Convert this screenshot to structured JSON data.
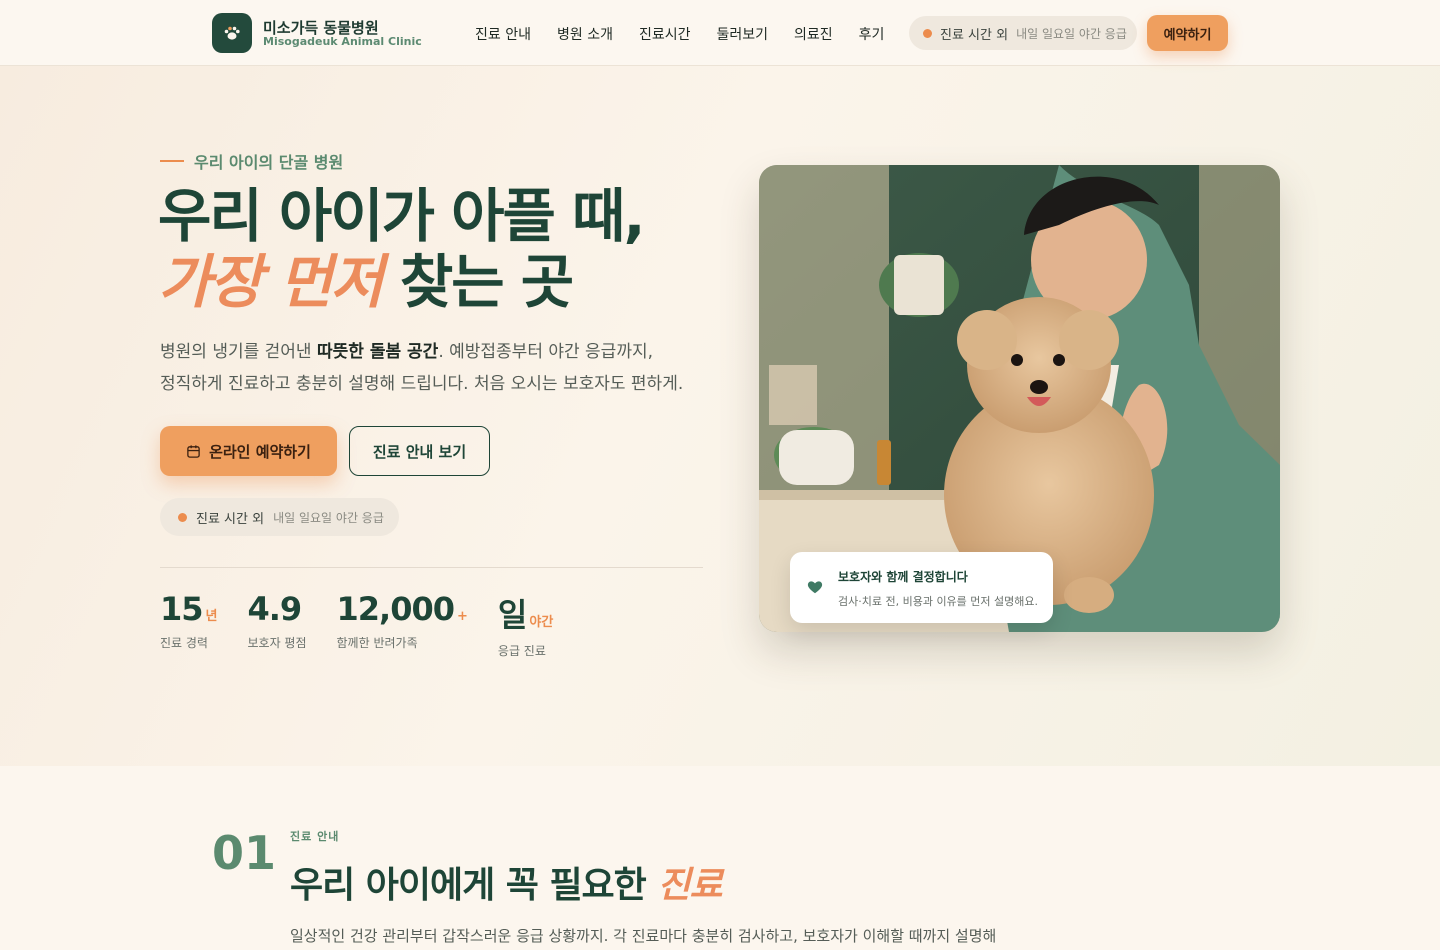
{
  "header": {
    "logo_name": "미소가득 동물병원",
    "logo_sub": "Misogadeuk Animal Clinic",
    "nav": [
      "진료 안내",
      "병원 소개",
      "진료시간",
      "둘러보기",
      "의료진",
      "후기"
    ],
    "hours_main": "진료 시간 외",
    "hours_sub": "내일 일요일 야간 응급",
    "book_label": "예약하기"
  },
  "hero": {
    "eyebrow": "우리 아이의 단골 병원",
    "title_line1": "우리 아이가 아플 때,",
    "title_accent": "가장 먼저",
    "title_rest": " 찾는 곳",
    "lead_pre": "병원의 냉기를 걷어낸 ",
    "lead_bold": "따뜻한 돌봄 공간",
    "lead_post": ". 예방접종부터 야간 응급까지,",
    "lead_line2": "정직하게 진료하고 충분히 설명해 드립니다. 처음 오시는 보호자도 편하게.",
    "cta_primary": "온라인 예약하기",
    "cta_secondary": "진료 안내 보기",
    "hours_main": "진료 시간 외",
    "hours_sub": "내일 일요일 야간 응급",
    "stats": [
      {
        "num": "15",
        "unit": "년",
        "label": "진료 경력"
      },
      {
        "num": "4.9",
        "unit": "",
        "label": "보호자 평점"
      },
      {
        "num": "12,000",
        "unit": "+",
        "label": "함께한 반려가족"
      },
      {
        "num": "일",
        "unit": "야간",
        "label": "응급 진료"
      }
    ],
    "caption_title": "보호자와 함께 결정합니다",
    "caption_sub": "검사·치료 전, 비용과 이유를 먼저 설명해요."
  },
  "section": {
    "number": "01",
    "eyebrow": "진료 안내",
    "title_pre": "우리 아이에게 꼭 필요한 ",
    "title_accent": "진료",
    "desc": "일상적인 건강 관리부터 갑작스러운 응급 상황까지. 각 진료마다 충분히 검사하고, 보호자가 이해할 때까지 설명해"
  },
  "icons": {
    "logo": "paw-icon",
    "calendar": "calendar-icon",
    "heart": "heart-icon"
  },
  "colors": {
    "primary_green": "#1e4537",
    "accent_orange": "#ef9f5f",
    "accent_coral": "#ec8c5c",
    "background": "#fcf6ee"
  }
}
